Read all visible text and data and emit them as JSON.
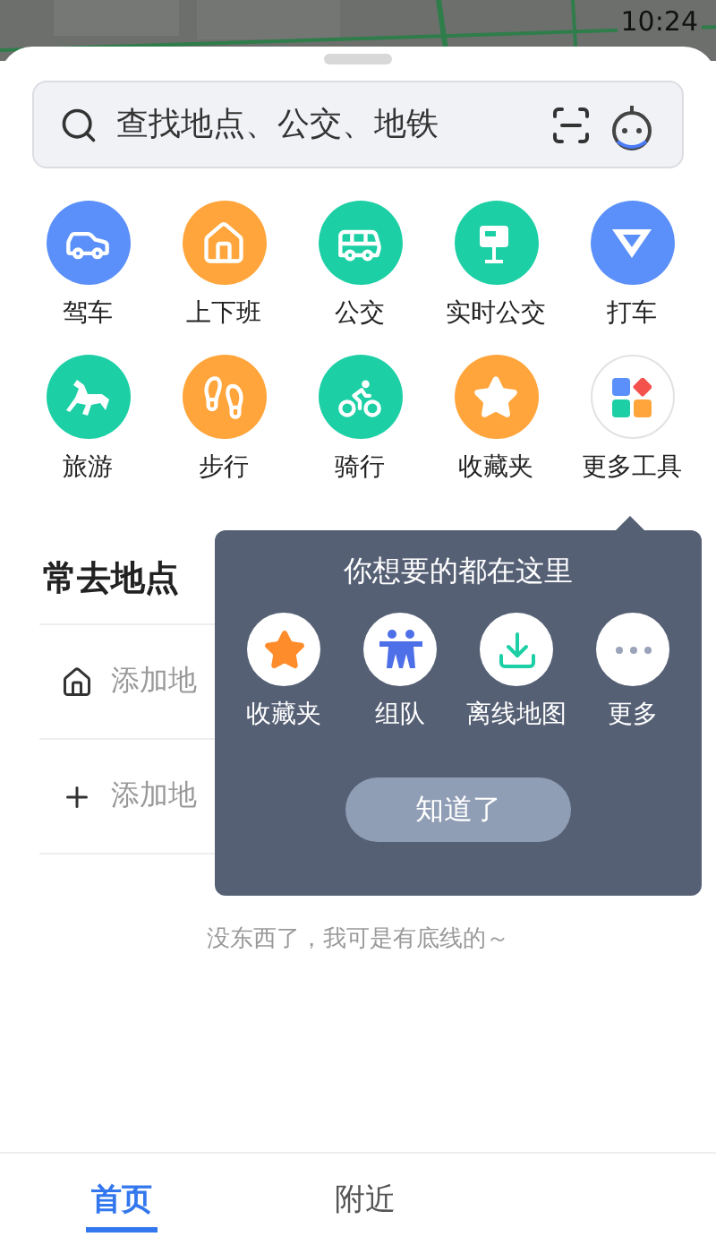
{
  "status_bar": {
    "time": "10:24"
  },
  "search": {
    "placeholder": "查找地点、公交、地铁"
  },
  "tools": [
    {
      "label": "驾车",
      "color": "#5b8ff9"
    },
    {
      "label": "上下班",
      "color": "#ffa53b"
    },
    {
      "label": "公交",
      "color": "#1ccfa5"
    },
    {
      "label": "实时公交",
      "color": "#1ccfa5"
    },
    {
      "label": "打车",
      "color": "#5b8ff9"
    },
    {
      "label": "旅游",
      "color": "#1ccfa5"
    },
    {
      "label": "步行",
      "color": "#ffa53b"
    },
    {
      "label": "骑行",
      "color": "#1ccfa5"
    },
    {
      "label": "收藏夹",
      "color": "#ffa53b"
    },
    {
      "label": "更多工具",
      "color": "#ffffff"
    }
  ],
  "frequent_places": {
    "title": "常去地点",
    "rows": [
      {
        "kind": "home",
        "text": "添加地"
      },
      {
        "kind": "add",
        "text": "添加地"
      }
    ]
  },
  "popover": {
    "title": "你想要的都在这里",
    "items": [
      {
        "label": "收藏夹"
      },
      {
        "label": "组队"
      },
      {
        "label": "离线地图"
      },
      {
        "label": "更多"
      }
    ],
    "button": "知道了"
  },
  "footer": "没东西了，我可是有底线的～",
  "tabs": [
    {
      "label": "首页",
      "selected": true
    },
    {
      "label": "附近",
      "selected": false
    }
  ]
}
